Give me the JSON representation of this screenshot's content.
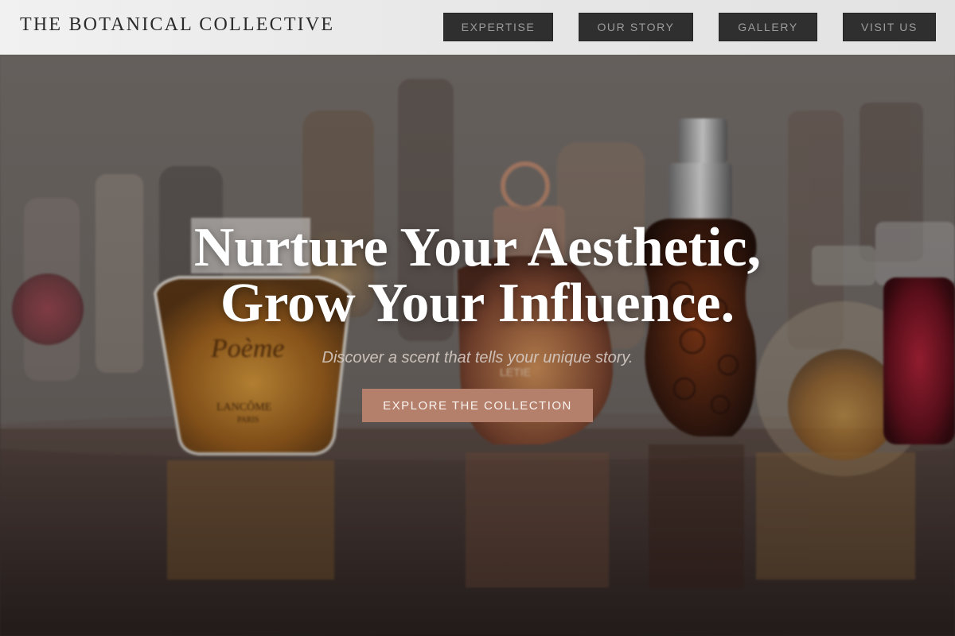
{
  "header": {
    "brand": "THE BOTANICAL COLLECTIVE",
    "nav": [
      {
        "label": "EXPERTISE"
      },
      {
        "label": "OUR STORY"
      },
      {
        "label": "GALLERY"
      },
      {
        "label": "VISIT US"
      }
    ]
  },
  "hero": {
    "title_line1": "Nurture Your Aesthetic,",
    "title_line2": "Grow Your Influence.",
    "subtitle": "Discover a scent that tells your unique story.",
    "cta_label": "EXPLORE THE COLLECTION",
    "image_alt": "Collection of perfume bottles on a reflective table"
  },
  "colors": {
    "header_bg": "#ebebeb",
    "nav_bg": "#2f2f30",
    "nav_text": "#9c9c9c",
    "cta_bg": "#b4806c",
    "title": "#ffffff"
  }
}
